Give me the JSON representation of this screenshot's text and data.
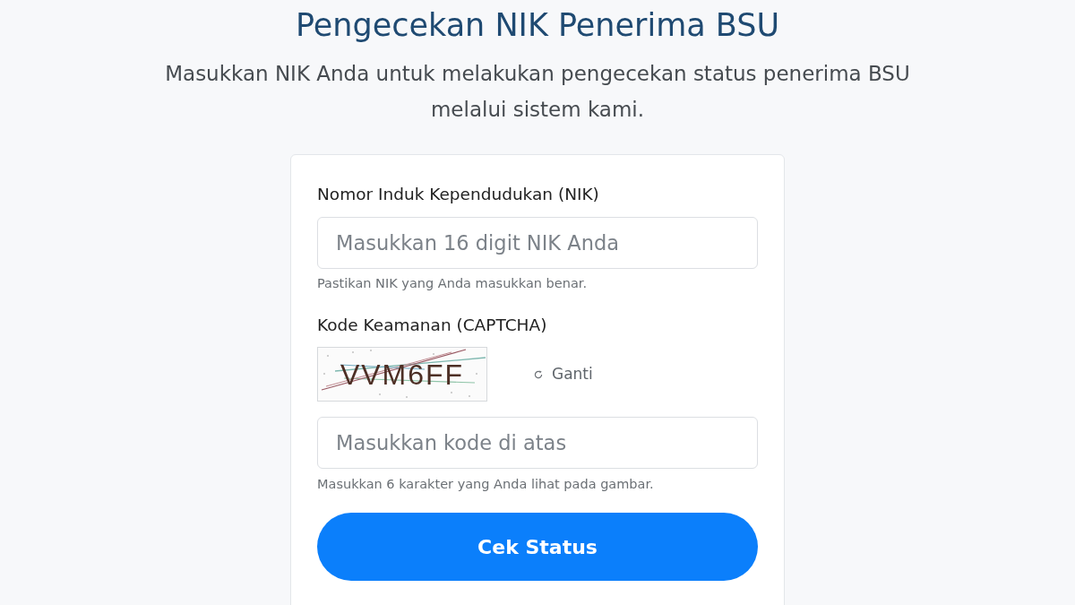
{
  "header": {
    "title": "Pengecekan NIK Penerima BSU",
    "subtitle": "Masukkan NIK Anda untuk melakukan pengecekan status penerima BSU melalui sistem kami."
  },
  "form": {
    "fields": [
      {
        "kind": "text",
        "label": "Nomor Induk Kependudukan (NIK)",
        "placeholder": "Masukkan 16 digit NIK Anda",
        "hint": "Pastikan NIK yang Anda masukkan benar."
      },
      {
        "kind": "captcha",
        "label": "Kode Keamanan (CAPTCHA)",
        "captcha_code": "VVM6FF",
        "refresh_label": "Ganti",
        "placeholder": "Masukkan kode di atas",
        "hint": "Masukkan 6 karakter yang Anda lihat pada gambar."
      }
    ],
    "submit_button": "Cek Status"
  }
}
